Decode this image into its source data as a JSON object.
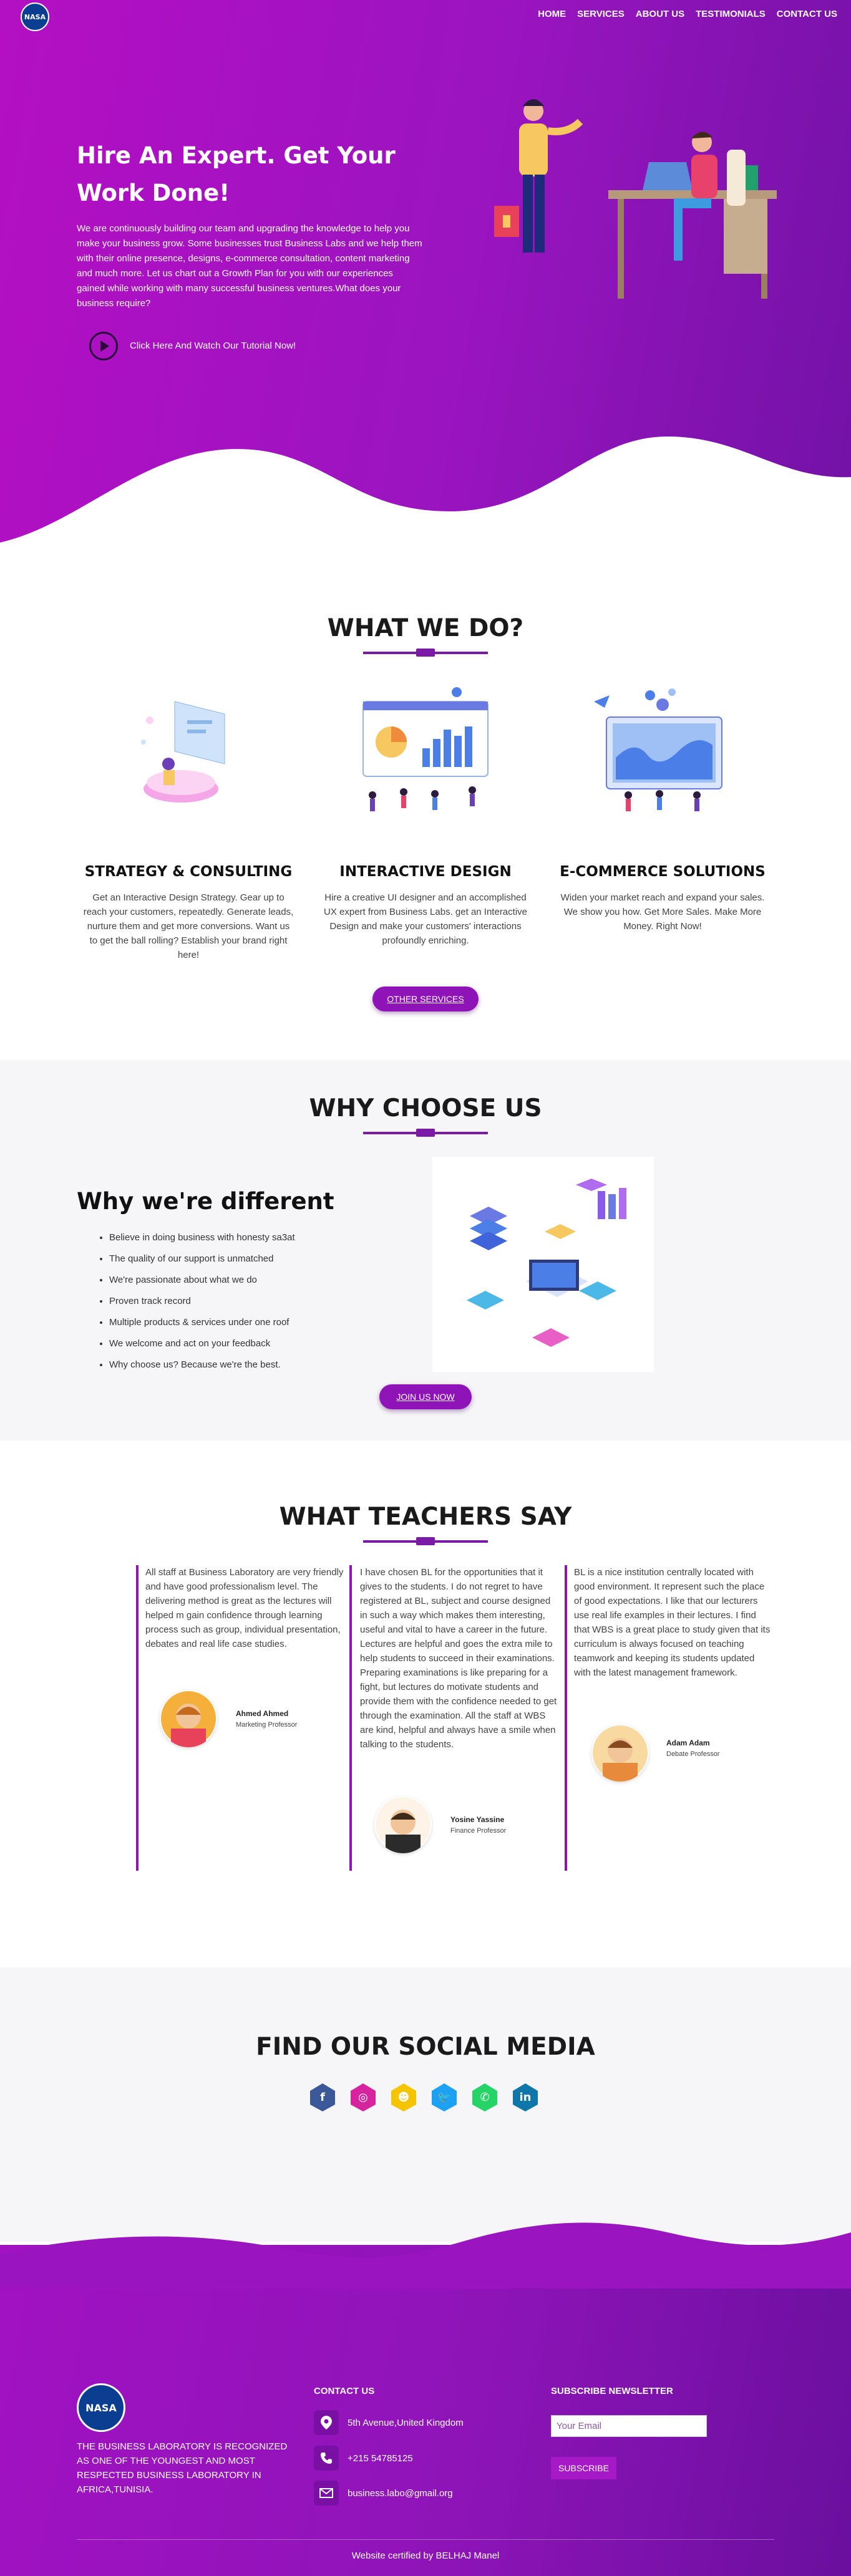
{
  "brand": {
    "logo_text": "NASA"
  },
  "nav": {
    "items": [
      "HOME",
      "SERVICES",
      "ABOUT US",
      "TESTIMONIALS",
      "CONTACT US"
    ]
  },
  "hero": {
    "title": "Hire An Expert. Get Your Work Done!",
    "text": "We are continuously building our team and upgrading the knowledge to help you make your business grow. Some businesses trust Business Labs and we help them with their online presence, designs, e-commerce consultation, content marketing and much more. Let us chart out a Growth Plan for you with our experiences gained while working with many successful business ventures.What does your business require?",
    "cta": "Click Here And Watch Our Tutorial Now!"
  },
  "what_we_do": {
    "title": "WHAT WE DO?",
    "services": [
      {
        "title": "STRATEGY & CONSULTING",
        "desc": "Get an Interactive Design Strategy. Gear up to reach your customers, repeatedly. Generate leads, nurture them and get more conversions. Want us to get the ball rolling? Establish your brand right here!"
      },
      {
        "title": "INTERACTIVE DESIGN",
        "desc": "Hire a creative UI designer and an accomplished UX expert from Business Labs. get an Interactive Design and make your customers' interactions profoundly enriching."
      },
      {
        "title": "E-COMMERCE SOLUTIONS",
        "desc": "Widen your market reach and expand your sales. We show you how. Get More Sales. Make More Money. Right Now!"
      }
    ],
    "button": "OTHER SERVICES"
  },
  "why_choose": {
    "title": "WHY CHOOSE US",
    "heading": "Why we're different",
    "items": [
      "Believe in doing business with honesty sa3at",
      "The quality of our support is unmatched",
      "We're passionate about what we do",
      "Proven track record",
      "Multiple products & services under one roof",
      "We welcome and act on your feedback",
      "Why choose us? Because we're the best."
    ],
    "button": "JOIN US NOW"
  },
  "teachers": {
    "title": "WHAT TEACHERS SAY",
    "items": [
      {
        "text": "All staff at Business Laboratory are very friendly and have good professionalism level. The delivering method is great as the lectures will helped m gain confidence through learning process such as group, individual presentation, debates and real life case studies.",
        "name": "Ahmed Ahmed",
        "role": "Marketing Professor"
      },
      {
        "text": "I have chosen BL for the opportunities that it gives to the students. I do not regret to have registered at BL, subject and course designed in such a way which makes them interesting, useful and vital to have a career in the future. Lectures are helpful and goes the extra mile to help students to succeed in their examinations. Preparing examinations is like preparing for a fight, but lectures do motivate students and provide them with the confidence needed to get through the examination. All the staff at WBS are kind, helpful and always have a smile when talking to the students.",
        "name": "Yosine Yassine",
        "role": "Finance Professor"
      },
      {
        "text": "BL is a nice institution centrally located with good environment. It represent such the place of good expectations. I like that our lecturers use real life examples in their lectures. I find that WBS is a great place to study given that its curriculum is always focused on teaching teamwork and keeping its students updated with the latest management framework.",
        "name": "Adam Adam",
        "role": "Debate Professor"
      }
    ]
  },
  "social": {
    "title": "FIND OUR SOCIAL MEDIA",
    "icons": [
      {
        "name": "facebook-icon",
        "glyph": "f",
        "color": "#3b5998"
      },
      {
        "name": "instagram-icon",
        "glyph": "◎",
        "color": "#d6249f"
      },
      {
        "name": "snapchat-icon",
        "glyph": "☻",
        "color": "#f5c400"
      },
      {
        "name": "twitter-icon",
        "glyph": "🐦",
        "color": "#1da1f2"
      },
      {
        "name": "whatsapp-icon",
        "glyph": "✆",
        "color": "#25d366"
      },
      {
        "name": "linkedin-icon",
        "glyph": "in",
        "color": "#0e76a8"
      }
    ]
  },
  "footer": {
    "about": "THE BUSINESS LABORATORY IS RECOGNIZED AS ONE OF THE YOUNGEST AND MOST RESPECTED BUSINESS LABORATORY IN AFRICA,TUNISIA.",
    "contact_title": "CONTACT US",
    "address": "5th Avenue,United Kingdom",
    "phone": "+215 54785125",
    "email": "business.labo@gmail.org",
    "newsletter_title": "SUBSCRIBE NEWSLETTER",
    "email_placeholder": "Your Email",
    "subscribe_label": "SUBSCRIBE",
    "certified": "Website certified by BELHAJ Manel"
  },
  "colors": {
    "primary": "#9a14c0",
    "dark": "#6a0f9e",
    "accent": "#8e14b8"
  }
}
